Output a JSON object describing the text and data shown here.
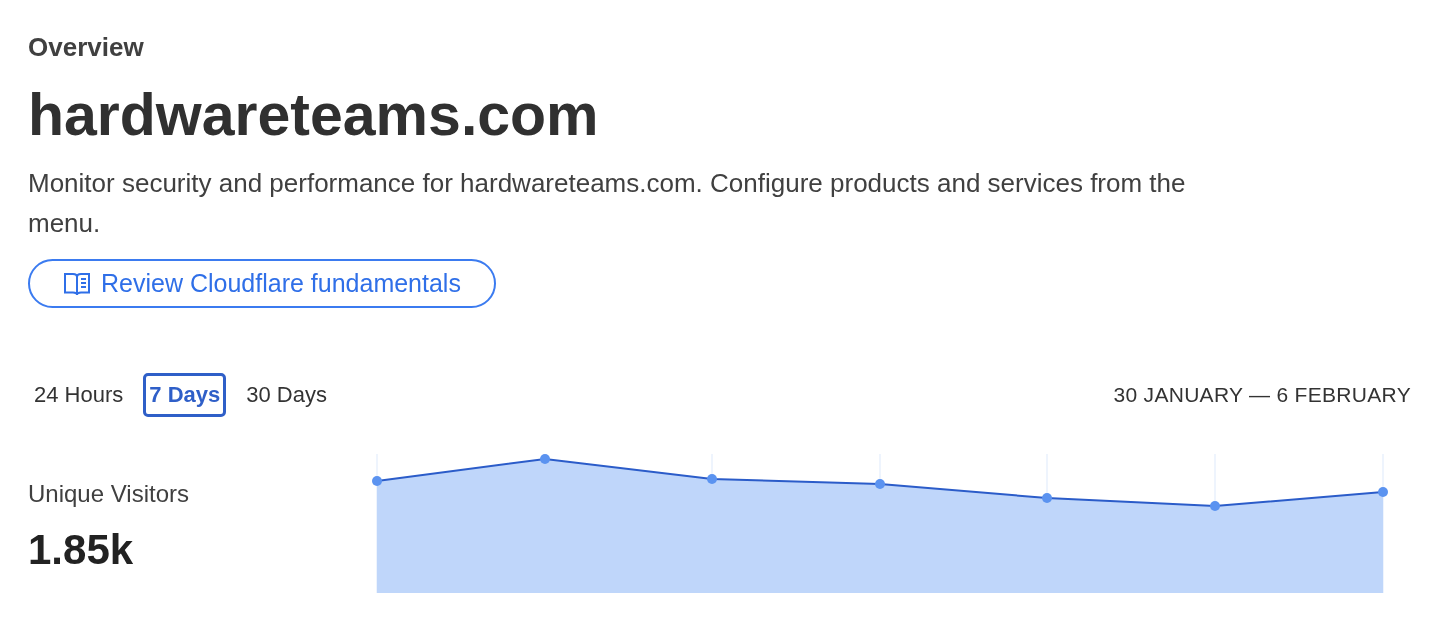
{
  "section_label": "Overview",
  "title": "hardwareteams.com",
  "description": "Monitor security and performance for hardwareteams.com. Configure products and services from the menu.",
  "fundamentals_button": {
    "label": "Review Cloudflare fundamentals"
  },
  "range_tabs": [
    {
      "label": "24 Hours",
      "selected": false
    },
    {
      "label": "7 Days",
      "selected": true
    },
    {
      "label": "30 Days",
      "selected": false
    }
  ],
  "date_range": "30 JANUARY — 6 FEBRUARY",
  "metric": {
    "label": "Unique Visitors",
    "value": "1.85k"
  }
}
